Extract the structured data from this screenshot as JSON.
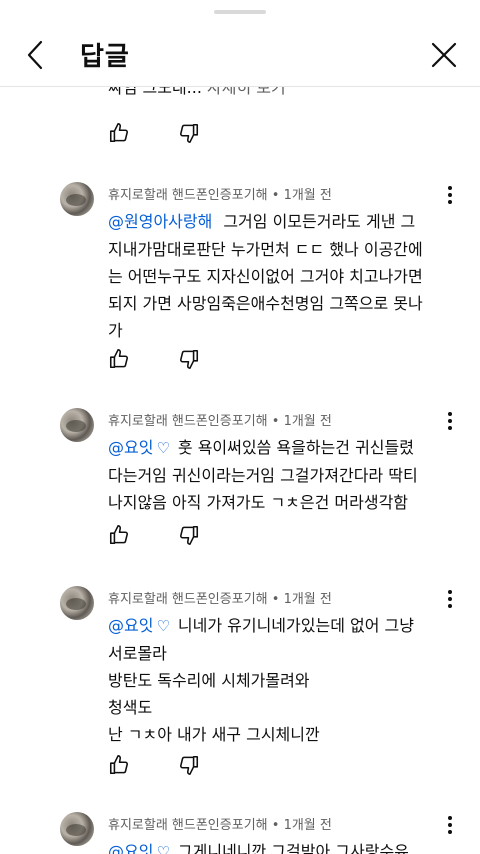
{
  "header": {
    "title": "답글"
  },
  "partial_comment": {
    "text": "싸임 그노대...",
    "more_label": "자세히 보기"
  },
  "comments": [
    {
      "author": "휴지로할래 핸드폰인증포기해",
      "time": "1개월 전",
      "mention": "@원영아사랑해",
      "heart": "",
      "lines": [
        "그거임 이모든거라도 게낸 그",
        "지내가맘대로판단 누가먼처 ㄷㄷ 했나 이공간에",
        "는 어떤누구도 지자신이없어 그거야 치고나가면",
        "되지 가면 사망임죽은애수천명임 그쪽으로 못나",
        "가"
      ]
    },
    {
      "author": "휴지로할래 핸드폰인증포기해",
      "time": "1개월 전",
      "mention": "@요잇",
      "heart": "♡",
      "lines": [
        "훗 욕이써있씀 욕을하는건 귀신들렸",
        "다는거임 귀신이라는거임 그걸가져간다라 딱티",
        "나지않음 아직 가져가도 ㄱㅊ은건 머라생각함"
      ]
    },
    {
      "author": "휴지로할래 핸드폰인증포기해",
      "time": "1개월 전",
      "mention": "@요잇",
      "heart": "♡",
      "lines": [
        "니네가 유기니네가있는데 없어 그냥",
        "서로몰라",
        "방탄도 독수리에 시체가몰려와",
        "청색도",
        "난 ㄱㅊ아 내가 새구 그시체니깐"
      ]
    },
    {
      "author": "휴지로할래 핸드폰인증포기해",
      "time": "1개월 전",
      "mention": "@요잇",
      "heart": "♡",
      "lines": [
        "그게니네니깐 그걸받아 그사랑수유"
      ]
    }
  ]
}
